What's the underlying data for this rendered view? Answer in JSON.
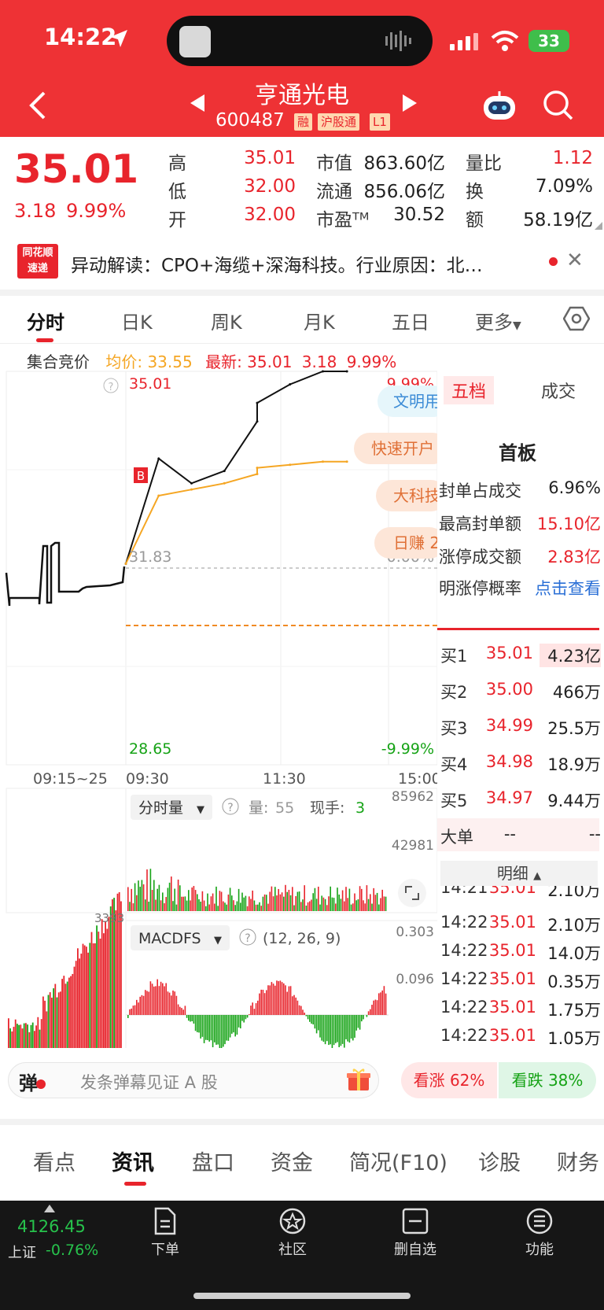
{
  "status": {
    "time": "14:22",
    "battery": "33"
  },
  "header": {
    "name": "亨通光电",
    "code": "600487",
    "tags": [
      "融",
      "沪股通",
      "L1"
    ]
  },
  "quote": {
    "price": "35.01",
    "change": "3.18",
    "pct": "9.99%",
    "rows": [
      {
        "l1": "高",
        "v1": "35.01",
        "l2": "市值",
        "v2": "863.60亿",
        "l3": "量比",
        "v3": "1.12"
      },
      {
        "l1": "低",
        "v1": "32.00",
        "l2": "流通",
        "v2": "856.06亿",
        "l3": "换",
        "v3": "7.09%"
      },
      {
        "l1": "开",
        "v1": "32.00",
        "l2": "市盈ᵀᴹ",
        "v2": "30.52",
        "l3": "额",
        "v3": "58.19亿"
      }
    ]
  },
  "news": {
    "logo_top": "同花顺",
    "logo_bottom": "速递",
    "text": "异动解读：CPO+海缆+深海科技。行业原因：北…"
  },
  "chart_tabs": [
    "分时",
    "日K",
    "周K",
    "月K",
    "五日",
    "更多"
  ],
  "info": {
    "auction": "集合竞价",
    "avg": "均价: 33.55",
    "latest": "最新: 35.01",
    "chg": "3.18",
    "pct": "9.99%"
  },
  "chart": {
    "top_price": "35.01",
    "top_pct": "9.99%",
    "mid_price": "31.83",
    "mid_pct": "0.00%",
    "bottom_price": "28.65",
    "bottom_pct": "-9.99%",
    "times": [
      "09:15~25",
      "09:30",
      "11:30",
      "15:00"
    ],
    "buy_marker": "B",
    "overlays": [
      "文明用",
      "快速开户",
      "大科技",
      "日赚 2"
    ],
    "volume": {
      "mode": "分时量",
      "vol_label": "量:",
      "vol_value": "55",
      "hand_label": "现手:",
      "hand_value": "3",
      "max": "85962",
      "mid": "42981",
      "left_max": "3393"
    },
    "macd": {
      "name": "MACDFS",
      "params": "(12, 26, 9)",
      "max": "0.303",
      "mid": "0.096"
    }
  },
  "chart_data": {
    "type": "line",
    "title": "",
    "xlabel": "",
    "ylabel": "",
    "x": [
      "09:30",
      "10:00",
      "10:30",
      "11:00",
      "11:30",
      "13:00",
      "13:30",
      "14:00",
      "14:22"
    ],
    "series": [
      {
        "name": "",
        "values": [
          31.9,
          33.6,
          33.2,
          33.4,
          34.2,
          34.5,
          34.8,
          35.01,
          35.01
        ]
      },
      {
        "name": "均价",
        "values": [
          31.9,
          33.0,
          33.1,
          33.2,
          33.35,
          33.45,
          33.5,
          33.55,
          33.55
        ]
      }
    ],
    "ylim": [
      28.65,
      35.01
    ]
  },
  "book": {
    "tabs": [
      "五档",
      "成交"
    ],
    "title": "首板",
    "stats": [
      {
        "label": "封单占成交",
        "value": "6.96%"
      },
      {
        "label": "最高封单额",
        "value": "15.10亿"
      },
      {
        "label": "涨停成交额",
        "value": "2.83亿"
      },
      {
        "label": "明涨停概率",
        "value": "点击查看"
      }
    ],
    "bids": [
      {
        "label": "买1",
        "price": "35.01",
        "vol": "4.23亿"
      },
      {
        "label": "买2",
        "price": "35.00",
        "vol": "466万"
      },
      {
        "label": "买3",
        "price": "34.99",
        "vol": "25.5万"
      },
      {
        "label": "买4",
        "price": "34.98",
        "vol": "18.9万"
      },
      {
        "label": "买5",
        "price": "34.97",
        "vol": "9.44万"
      }
    ],
    "big": {
      "label": "大单",
      "v1": "--",
      "v2": "--"
    },
    "detail_label": "明细",
    "detail": [
      {
        "time": "14:21",
        "price": "35.01",
        "vol": "2.10万"
      },
      {
        "time": "14:22",
        "price": "35.01",
        "vol": "2.10万"
      },
      {
        "time": "14:22",
        "price": "35.01",
        "vol": "14.0万"
      },
      {
        "time": "14:22",
        "price": "35.01",
        "vol": "0.35万"
      },
      {
        "time": "14:22",
        "price": "35.01",
        "vol": "1.75万"
      },
      {
        "time": "14:22",
        "price": "35.01",
        "vol": "1.05万"
      }
    ]
  },
  "danmu": {
    "icon": "弹",
    "placeholder": "发条弹幕见证 A 股",
    "rise": "看涨 62%",
    "fall": "看跌 38%"
  },
  "bottom_tabs": [
    "看点",
    "资讯",
    "盘口",
    "资金",
    "简况(F10)",
    "诊股",
    "财务"
  ],
  "footer": {
    "index_value": "4126.45",
    "index_name": "上证",
    "index_pct": "-0.76%",
    "nav": [
      "下单",
      "社区",
      "删自选",
      "功能"
    ]
  },
  "colors": {
    "header": "#ee3235",
    "up": "#e8242c",
    "down": "#16a316",
    "avg_line": "#f5a623",
    "footer": "#161616"
  }
}
